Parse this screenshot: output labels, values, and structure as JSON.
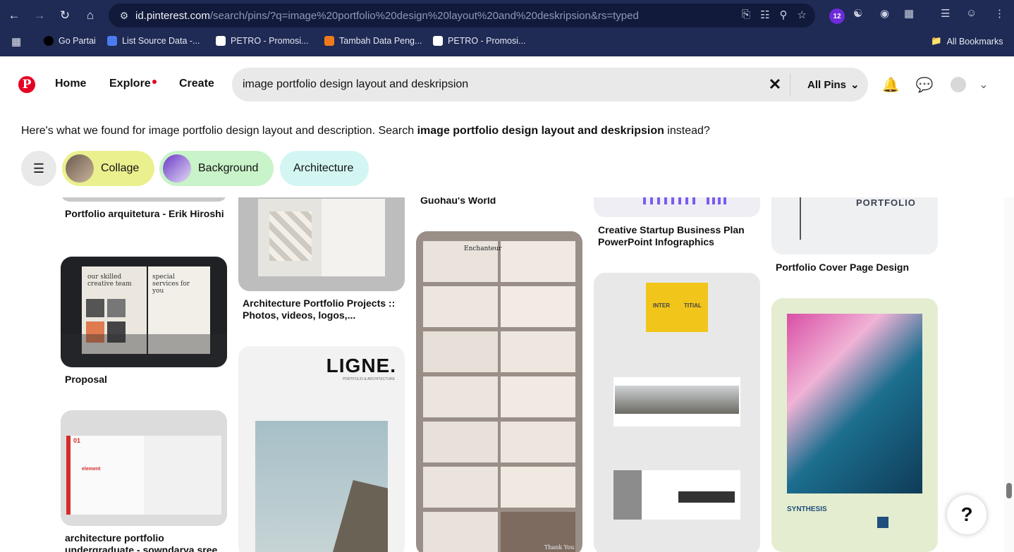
{
  "browser": {
    "url_host": "id.pinterest.com",
    "url_path": "/search/pins/?q=image%20portfolio%20design%20layout%20and%20deskripsion&rs=typed",
    "extension_badge": "12",
    "bookmarks": [
      "Go Partai",
      "List Source Data -...",
      "PETRO - Promosi...",
      "Tambah Data Peng...",
      "PETRO - Promosi..."
    ],
    "all_bookmarks": "All Bookmarks"
  },
  "header": {
    "logo": "P",
    "nav": [
      "Home",
      "Explore",
      "Create"
    ],
    "search_value": "image portfolio design layout and deskripsion",
    "filter_label": "All Pins"
  },
  "suggestion": {
    "prefix": "Here's what we found for image portfolio design layout and description. Search ",
    "query": "image portfolio design layout and deskripsion",
    "suffix": " instead?"
  },
  "chips": [
    "Collage",
    "Background",
    "Architecture"
  ],
  "pins": {
    "col1": [
      "Portfolio arquitetura - Erik Hiroshi",
      "Proposal",
      "architecture portfolio undergraduate - sowndarya sree"
    ],
    "col2": [
      "Architecture Portfolio Projects :: Photos, videos, logos,...",
      "LIGNE.",
      "PORTFOLIO & ARCHITECTURE"
    ],
    "col3": [
      "Guohau's World",
      "Enchanteur",
      "Thank You"
    ],
    "col4": [
      "Creative Startup Business Plan PowerPoint Infographics",
      "INTER",
      "TITIAL"
    ],
    "col5": [
      "PORTFOLIO",
      "Portfolio Cover Page Design",
      "SYNTHESIS"
    ]
  },
  "mockup_text": {
    "proposal_left": "our skilled creative team",
    "proposal_right": "special services for you",
    "arch_num": "01",
    "arch_word": "element"
  },
  "help": "?",
  "colors": {
    "brand": "#e60023",
    "chrome": "#1f2a55",
    "chip_collage": "#eaf08e",
    "chip_background": "#c9f3c9",
    "chip_architecture": "#d3f6f3"
  }
}
